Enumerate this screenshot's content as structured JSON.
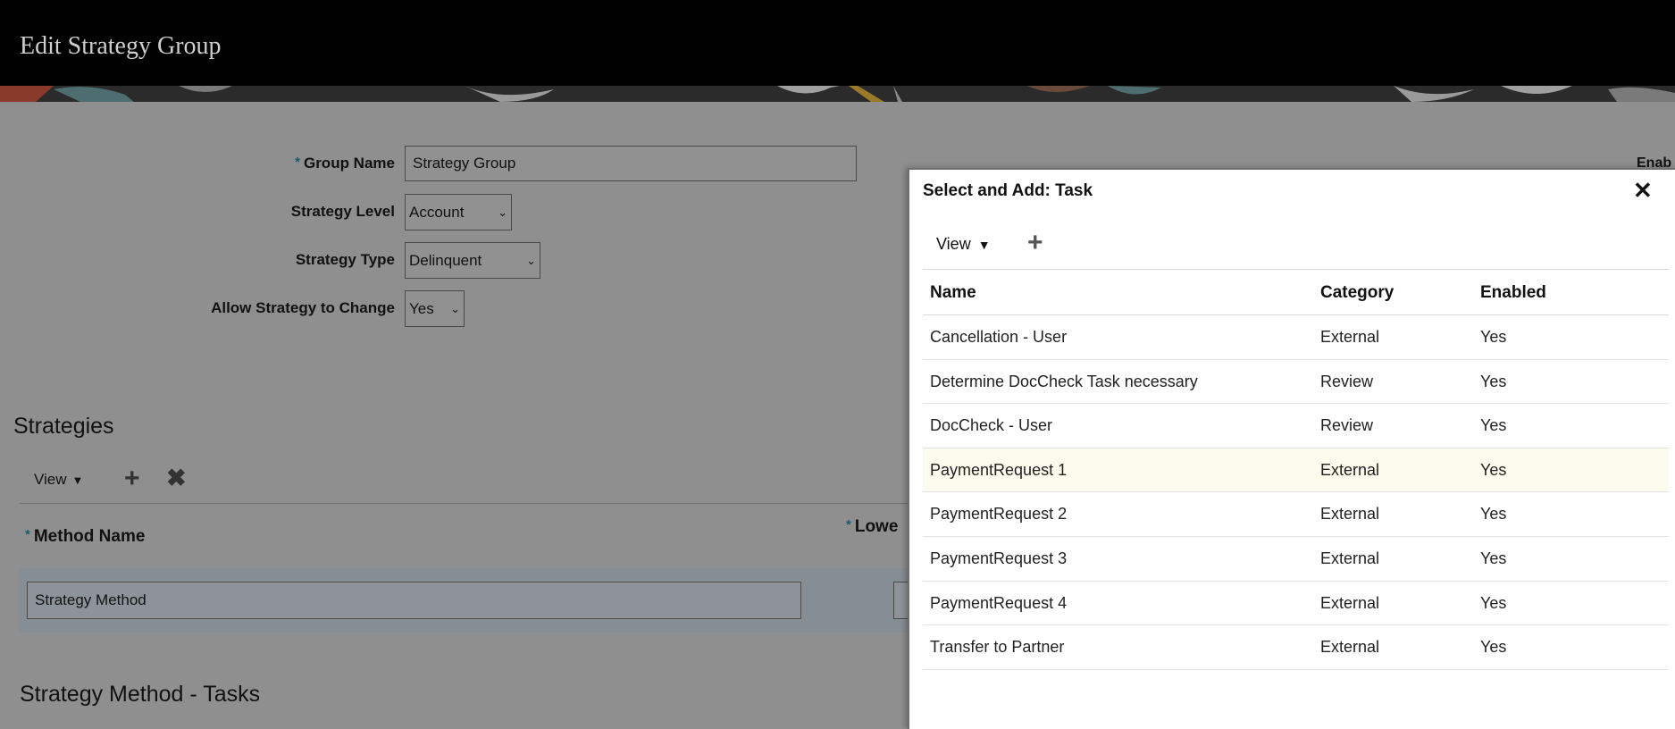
{
  "header": {
    "title": "Edit Strategy Group"
  },
  "form": {
    "group_name_label": "Group Name",
    "group_name_value": "Strategy Group",
    "strategy_level_label": "Strategy Level",
    "strategy_level_value": "Account",
    "strategy_type_label": "Strategy Type",
    "strategy_type_value": "Delinquent",
    "allow_change_label": "Allow Strategy to Change",
    "allow_change_value": "Yes",
    "required_marker": "*"
  },
  "partial_right_label": "Enab",
  "strategies": {
    "title": "Strategies",
    "view_label": "View",
    "col_method_name": "Method Name",
    "col_lower_partial": "Lowe",
    "method_value": "Strategy Method"
  },
  "tasks_section": {
    "title": "Strategy Method -  Tasks"
  },
  "modal": {
    "title": "Select and Add: Task",
    "view_label": "View",
    "columns": {
      "name": "Name",
      "category": "Category",
      "enabled": "Enabled"
    },
    "rows": [
      {
        "name": "Cancellation - User",
        "category": "External",
        "enabled": "Yes"
      },
      {
        "name": "Determine DocCheck Task necessary",
        "category": "Review",
        "enabled": "Yes"
      },
      {
        "name": "DocCheck - User",
        "category": "Review",
        "enabled": "Yes"
      },
      {
        "name": "PaymentRequest 1",
        "category": "External",
        "enabled": "Yes"
      },
      {
        "name": "PaymentRequest 2",
        "category": "External",
        "enabled": "Yes"
      },
      {
        "name": "PaymentRequest 3",
        "category": "External",
        "enabled": "Yes"
      },
      {
        "name": "PaymentRequest 4",
        "category": "External",
        "enabled": "Yes"
      },
      {
        "name": "Transfer to Partner",
        "category": "External",
        "enabled": "Yes"
      }
    ],
    "highlighted_row": "PaymentRequest 1"
  },
  "icons": {
    "view_dropdown": "caret-down-icon",
    "add": "plus-icon",
    "delete": "x-icon",
    "close": "close-icon",
    "select_chevron": "chevron-down-icon"
  }
}
